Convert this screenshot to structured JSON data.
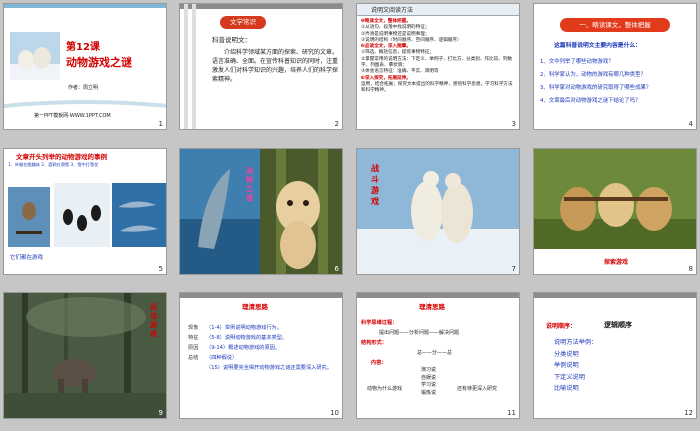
{
  "slides": [
    {
      "number": "1",
      "title": "第12课",
      "subtitle": "动物游戏之谜",
      "author": "作者：周立明",
      "footer": "第一PPT模板网-WWW.1PPT.COM"
    },
    {
      "number": "2",
      "badge": "文学常识",
      "heading": "科普说明文：",
      "body": "介绍科学领域某方面的探索、研究的文章。语言准确、全面。在宣传科普知识的同时，注重激发人们对科学知识的兴趣，培养人们的科学探索精神。"
    },
    {
      "number": "3",
      "title": "说明文阅读方法",
      "lines": [
        "❶略读全文，整体把握。",
        "①从语句、段落中找说明的特征；",
        "②弄清是说明事物还是说明事理；",
        "③说明的结构（时间顺序、空间顺序、逻辑顺序）",
        "❷品读全文，深入揣摩。",
        "①筛选、概括信息，提炼事物特征；",
        "②掌握常用的说明方法：下定义、举例子、打比方、分类别、作比较、列数字、列图表、摹状貌；",
        "③体会语言特征：准确、平实、简明等",
        "❸深入探究，拓展延伸。",
        "运用，结合拓展；探究文本提出的科学精神，感悟科学思想，学习科学方法和科学精神。"
      ]
    },
    {
      "number": "4",
      "banner": "一、略读课文，整体把握",
      "heading": "这篇科普说明文主要内容是什么：",
      "questions": [
        "1、文中列举了哪些动物游戏？",
        "2、科学家认为，动物的游戏有哪几种类型？",
        "3、科学家对动物游戏的研究取得了哪些成果？",
        "4、文章最后对动物游戏之谜下结论了吗？"
      ]
    },
    {
      "number": "5",
      "title": "文章开头列举的动物游戏的事例",
      "examples": [
        "1、叶猴在跳蹦床",
        "2、渡鸦在滑雪",
        "3、雪中打雪仗",
        "4、海豚玩耍"
      ],
      "caption": "它们都在游戏"
    },
    {
      "number": "6",
      "overlay": "动物之谜"
    },
    {
      "number": "7",
      "overlay": "战斗游戏"
    },
    {
      "number": "8",
      "caption": "探索游戏"
    },
    {
      "number": "9",
      "overlay": "运动游戏"
    },
    {
      "number": "10",
      "title": "理清思路",
      "side": [
        "现象",
        "特征",
        "原因",
        "总结"
      ],
      "items": [
        "（1-4）举例说明动物游戏行为。",
        "（5-8）说明动物游戏的基本类型。",
        "（9-14）概述动物游戏的原因。",
        "（四种假说）",
        "（15）说明要完全揭开动物游戏之谜还需要深入研究。"
      ]
    },
    {
      "number": "11",
      "title": "理清思路",
      "label1": "科学思维过程：",
      "flow": "提出问题——分析问题——解决问题",
      "label2": "结构形式：",
      "structure": "总——分——总",
      "label3": "内容：",
      "topic": "动物为什么游戏",
      "hypotheses": [
        "演习说",
        "自娱说",
        "学习说",
        "锻炼说"
      ],
      "note": "还有待更深入研究"
    },
    {
      "number": "12",
      "label": "说明顺序：",
      "order": "逻辑顺序",
      "methods": [
        "说明方法举例：",
        "分类说明",
        "举例说明",
        "下定义说明",
        "比喻说明"
      ]
    }
  ]
}
